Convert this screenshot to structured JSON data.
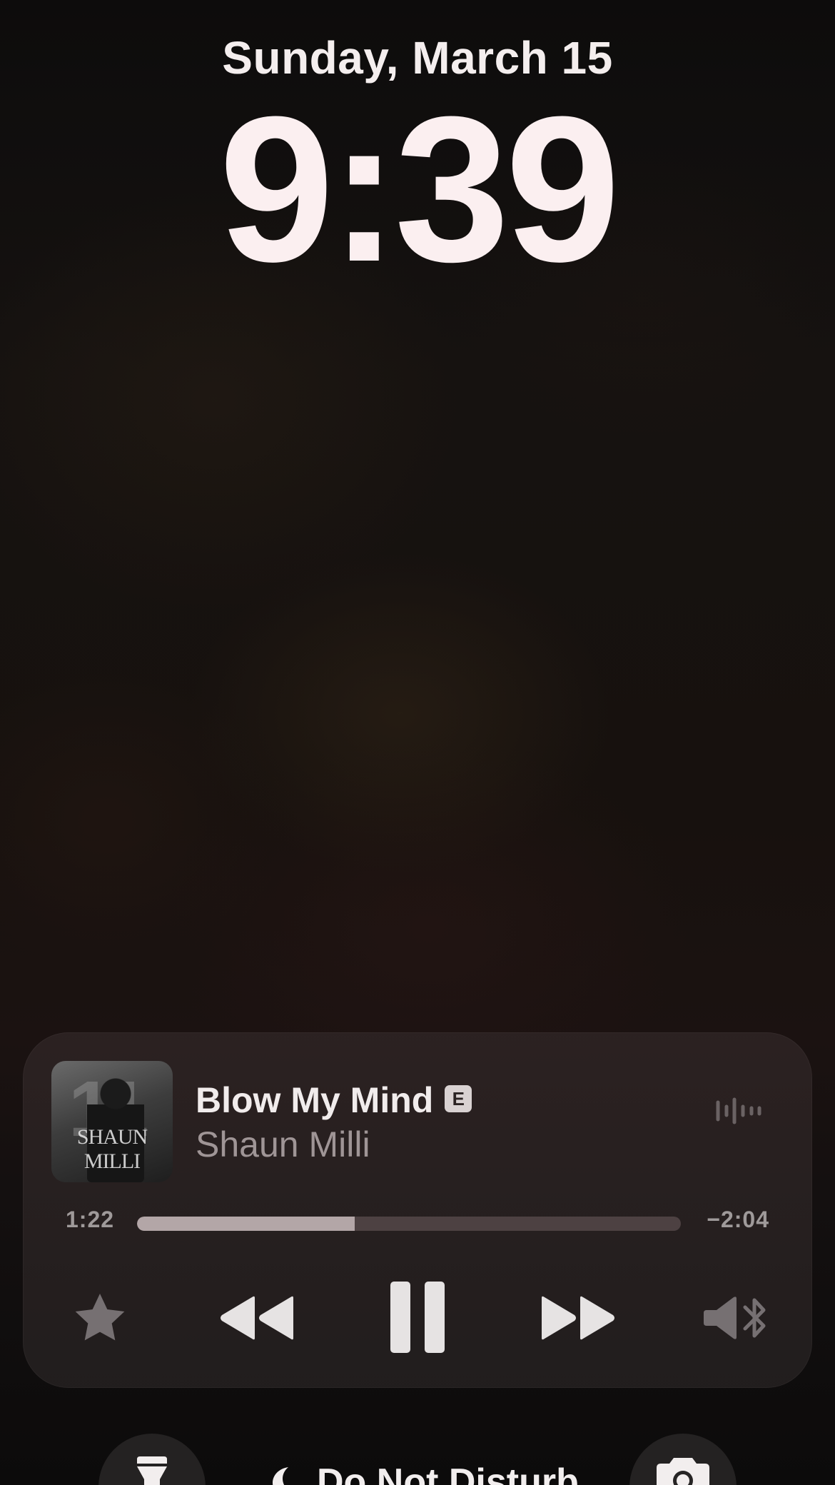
{
  "lock_screen": {
    "date": "Sunday, March 15",
    "time": "9:39"
  },
  "now_playing": {
    "artwork": {
      "number": "11",
      "artist_text": "SHAUN MILLI"
    },
    "title": "Blow My Mind",
    "explicit_badge": "E",
    "artist": "Shaun Milli",
    "elapsed": "1:22",
    "remaining": "−2:04",
    "progress_fraction": 0.4,
    "controls": {
      "favorite": "star-icon",
      "previous": "rewind-icon",
      "play_pause": "pause-icon",
      "next": "fast-forward-icon",
      "output": "speaker-bluetooth-icon"
    }
  },
  "dock": {
    "flashlight": "flashlight-icon",
    "focus_label": "Do Not Disturb",
    "focus_icon": "moon-icon",
    "camera": "camera-icon"
  },
  "colors": {
    "player_bg": "#2c2222",
    "progress_fill": "#b3a6a7",
    "progress_track": "#4d4142",
    "text_primary": "#f1ecec",
    "text_secondary": "#9f9596"
  }
}
